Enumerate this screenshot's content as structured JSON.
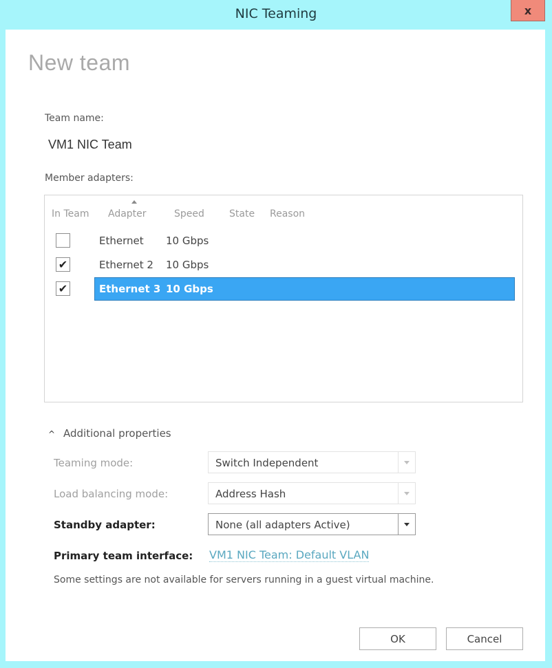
{
  "window": {
    "title": "NIC Teaming",
    "close_label": "x"
  },
  "dialog": {
    "heading": "New team",
    "team_name_label": "Team name:",
    "team_name_value": "VM1 NIC Team",
    "member_adapters_label": "Member adapters:"
  },
  "adapters_table": {
    "columns": [
      "In Team",
      "Adapter",
      "Speed",
      "State",
      "Reason"
    ],
    "sorted_column": "Adapter",
    "sort_direction": "ascending",
    "rows": [
      {
        "in_team": false,
        "adapter": "Ethernet",
        "speed": "10 Gbps",
        "state": "",
        "reason": "",
        "selected": false
      },
      {
        "in_team": true,
        "adapter": "Ethernet 2",
        "speed": "10 Gbps",
        "state": "",
        "reason": "",
        "selected": false
      },
      {
        "in_team": true,
        "adapter": "Ethernet 3",
        "speed": "10 Gbps",
        "state": "",
        "reason": "",
        "selected": true
      }
    ]
  },
  "additional_properties": {
    "toggle_label": "Additional properties",
    "expanded": true,
    "teaming_mode": {
      "label": "Teaming mode:",
      "value": "Switch Independent",
      "enabled": false
    },
    "load_balancing_mode": {
      "label": "Load balancing mode:",
      "value": "Address Hash",
      "enabled": false
    },
    "standby_adapter": {
      "label": "Standby adapter:",
      "value": "None (all adapters Active)",
      "enabled": true
    },
    "primary_team_interface": {
      "label": "Primary team interface:",
      "link_text": "VM1 NIC Team: Default VLAN"
    },
    "note": "Some settings are not available for servers running in a guest virtual machine."
  },
  "footer": {
    "ok_label": "OK",
    "cancel_label": "Cancel"
  },
  "colors": {
    "frame": "#a6f5fb",
    "close_button": "#f08a7a",
    "selection": "#3aa6f3",
    "link": "#5aa8c0"
  }
}
